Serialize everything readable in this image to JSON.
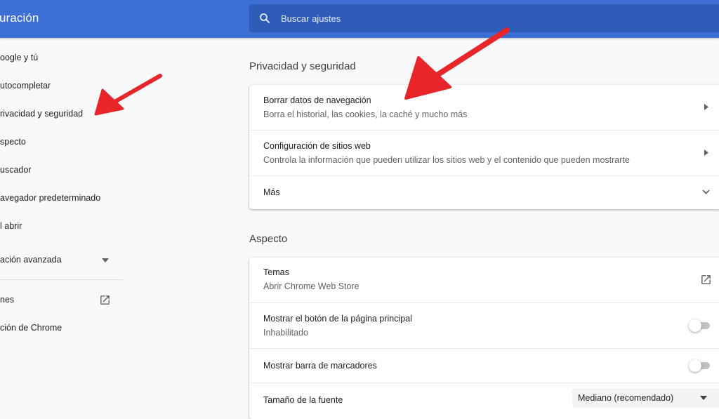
{
  "header": {
    "title": "uración",
    "search_placeholder": "Buscar ajustes"
  },
  "sidebar": {
    "items": [
      {
        "label": "oogle y tú"
      },
      {
        "label": "utocompletar"
      },
      {
        "label": "rivacidad y seguridad"
      },
      {
        "label": "specto"
      },
      {
        "label": "uscador"
      },
      {
        "label": "avegador predeterminado"
      },
      {
        "label": "l abrir"
      },
      {
        "label": "ación avanzada"
      },
      {
        "label": "nes"
      },
      {
        "label": "ción de Chrome"
      }
    ]
  },
  "privacy": {
    "title": "Privacidad y seguridad",
    "rows": [
      {
        "title": "Borrar datos de navegación",
        "subtitle": "Borra el historial, las cookies, la caché y mucho más"
      },
      {
        "title": "Configuración de sitios web",
        "subtitle": "Controla la información que pueden utilizar los sitios web y el contenido que pueden mostrarte"
      },
      {
        "title": "Más"
      }
    ]
  },
  "appearance": {
    "title": "Aspecto",
    "rows": [
      {
        "title": "Temas",
        "subtitle": "Abrir Chrome Web Store"
      },
      {
        "title": "Mostrar el botón de la página principal",
        "subtitle": "Inhabilitado",
        "toggle_on": false
      },
      {
        "title": "Mostrar barra de marcadores",
        "toggle_on": false
      },
      {
        "title": "Tamaño de la fuente",
        "select_value": "Mediano (recomendado)"
      }
    ]
  },
  "colors": {
    "header_bg": "#3c6fd6",
    "search_bg": "#2f5cb8",
    "annotation_arrow": "#e8262a"
  },
  "icons": [
    "search-icon",
    "chevron-down-icon",
    "external-link-icon",
    "chevron-right-icon",
    "toggle-switch",
    "annotation-arrow"
  ]
}
